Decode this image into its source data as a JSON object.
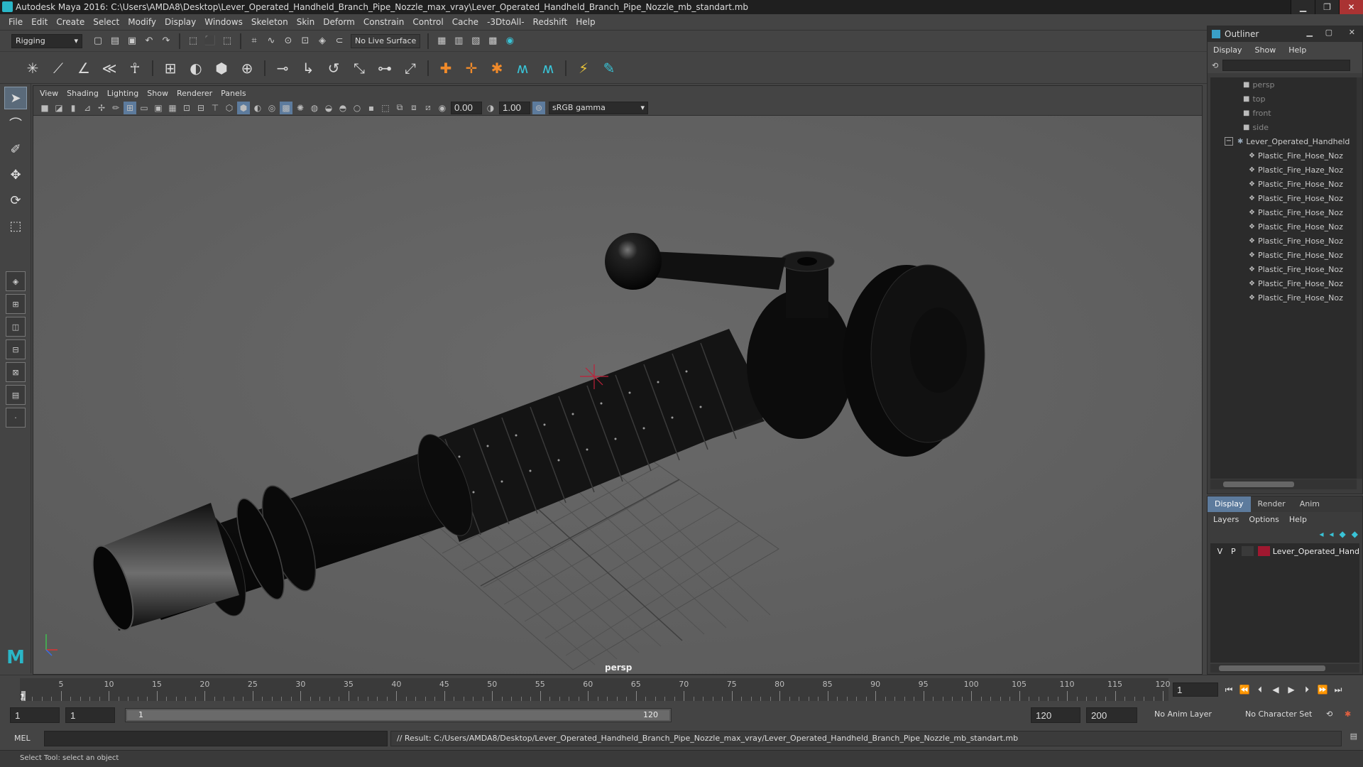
{
  "window": {
    "title": "Autodesk Maya 2016: C:\\Users\\AMDA8\\Desktop\\Lever_Operated_Handheld_Branch_Pipe_Nozzle_max_vray\\Lever_Operated_Handheld_Branch_Pipe_Nozzle_mb_standart.mb",
    "minimize": "▁",
    "restore": "❐",
    "close": "✕"
  },
  "menubar": [
    "File",
    "Edit",
    "Create",
    "Select",
    "Modify",
    "Display",
    "Windows",
    "Skeleton",
    "Skin",
    "Deform",
    "Constrain",
    "Control",
    "Cache",
    "-3DtoAll-",
    "Redshift",
    "Help"
  ],
  "status_line": {
    "mode": "Rigging",
    "live_surface": "No Live Surface"
  },
  "panel": {
    "menu": [
      "View",
      "Shading",
      "Lighting",
      "Show",
      "Renderer",
      "Panels"
    ],
    "exposure": "0.00",
    "gamma": "1.00",
    "color_space": "sRGB gamma",
    "camera_label": "persp"
  },
  "timeline": {
    "ticks": [
      "5",
      "10",
      "15",
      "20",
      "25",
      "30",
      "35",
      "40",
      "45",
      "50",
      "55",
      "60",
      "65",
      "70",
      "75",
      "80",
      "85",
      "90",
      "95",
      "100",
      "105",
      "110",
      "115",
      "120"
    ],
    "current_frame": "1",
    "frame_field": "1"
  },
  "range": {
    "start": "1",
    "playback_start": "1",
    "bar_start": "1",
    "bar_end": "120",
    "playback_end": "120",
    "end": "200",
    "anim_layer": "No Anim Layer",
    "character_set": "No Character Set"
  },
  "command": {
    "language": "MEL",
    "result": "// Result: C:/Users/AMDA8/Desktop/Lever_Operated_Handheld_Branch_Pipe_Nozzle_max_vray/Lever_Operated_Handheld_Branch_Pipe_Nozzle_mb_standart.mb"
  },
  "help_line": "Select Tool: select an object",
  "outliner": {
    "title": "Outliner",
    "menu": [
      "Display",
      "Show",
      "Help"
    ],
    "cameras": [
      "persp",
      "top",
      "front",
      "side"
    ],
    "group": "Lever_Operated_Handheld",
    "children": [
      "Plastic_Fire_Hose_Noz",
      "Plastic_Fire_Haze_Noz",
      "Plastic_Fire_Hose_Noz",
      "Plastic_Fire_Hose_Noz",
      "Plastic_Fire_Hose_Noz",
      "Plastic_Fire_Hose_Noz",
      "Plastic_Fire_Hose_Noz",
      "Plastic_Fire_Hose_Noz",
      "Plastic_Fire_Hose_Noz",
      "Plastic_Fire_Hose_Noz",
      "Plastic_Fire_Hose_Noz"
    ]
  },
  "layers": {
    "tabs": [
      "Display",
      "Render",
      "Anim"
    ],
    "menu": [
      "Layers",
      "Options",
      "Help"
    ],
    "layer_visible": "V",
    "layer_playback": "P",
    "layer_name": "Lever_Operated_Hand",
    "layer_color": "#a01830"
  },
  "colors": {
    "accent": "#5d7b9d",
    "maya_teal": "#2ab6c7"
  }
}
